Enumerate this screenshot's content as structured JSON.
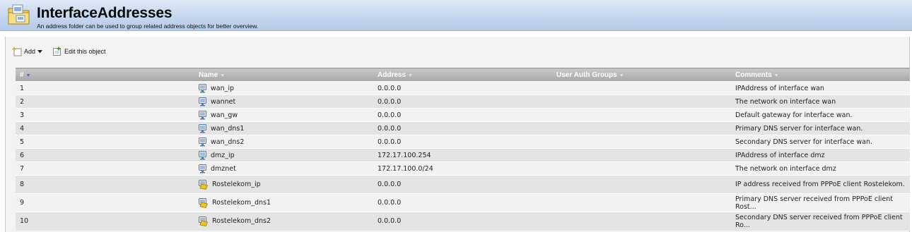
{
  "header": {
    "title": "InterfaceAddresses",
    "subtitle": "An address folder can be used to group related address objects for better overview.",
    "icon": "address-folder-icon"
  },
  "toolbar": {
    "add_label": "Add",
    "edit_label": "Edit this object"
  },
  "table": {
    "columns": [
      "#",
      "Name",
      "Address",
      "User Auth Groups",
      "Comments"
    ],
    "sorted_column": "#",
    "rows": [
      {
        "num": "1",
        "name": "wan_ip",
        "address": "0.0.0.0",
        "groups": "",
        "comment": "IPAddress of interface wan",
        "icon": "ip-address-icon"
      },
      {
        "num": "2",
        "name": "wannet",
        "address": "0.0.0.0",
        "groups": "",
        "comment": "The network on interface wan",
        "icon": "ip-address-icon"
      },
      {
        "num": "3",
        "name": "wan_gw",
        "address": "0.0.0.0",
        "groups": "",
        "comment": "Default gateway for interface wan.",
        "icon": "ip-address-icon"
      },
      {
        "num": "4",
        "name": "wan_dns1",
        "address": "0.0.0.0",
        "groups": "",
        "comment": "Primary DNS server for interface wan.",
        "icon": "ip-address-icon"
      },
      {
        "num": "5",
        "name": "wan_dns2",
        "address": "0.0.0.0",
        "groups": "",
        "comment": "Secondary DNS server for interface wan.",
        "icon": "ip-address-icon"
      },
      {
        "num": "6",
        "name": "dmz_ip",
        "address": "172.17.100.254",
        "groups": "",
        "comment": "IPAddress of interface dmz",
        "icon": "ip-address-icon"
      },
      {
        "num": "7",
        "name": "dmznet",
        "address": "172.17.100.0/24",
        "groups": "",
        "comment": "The network on interface dmz",
        "icon": "ip-address-icon"
      },
      {
        "num": "8",
        "name": "Rostelekom_ip",
        "address": "0.0.0.0",
        "groups": "",
        "comment": "IP address received from PPPoE client Rostelekom.",
        "icon": "locked-address-icon"
      },
      {
        "num": "9",
        "name": "Rostelekom_dns1",
        "address": "0.0.0.0",
        "groups": "",
        "comment": "Primary DNS server received from PPPoE client Rost...",
        "icon": "locked-address-icon"
      },
      {
        "num": "10",
        "name": "Rostelekom_dns2",
        "address": "0.0.0.0",
        "groups": "",
        "comment": "Secondary DNS server received from PPPoE client Ro...",
        "icon": "locked-address-icon"
      }
    ]
  }
}
